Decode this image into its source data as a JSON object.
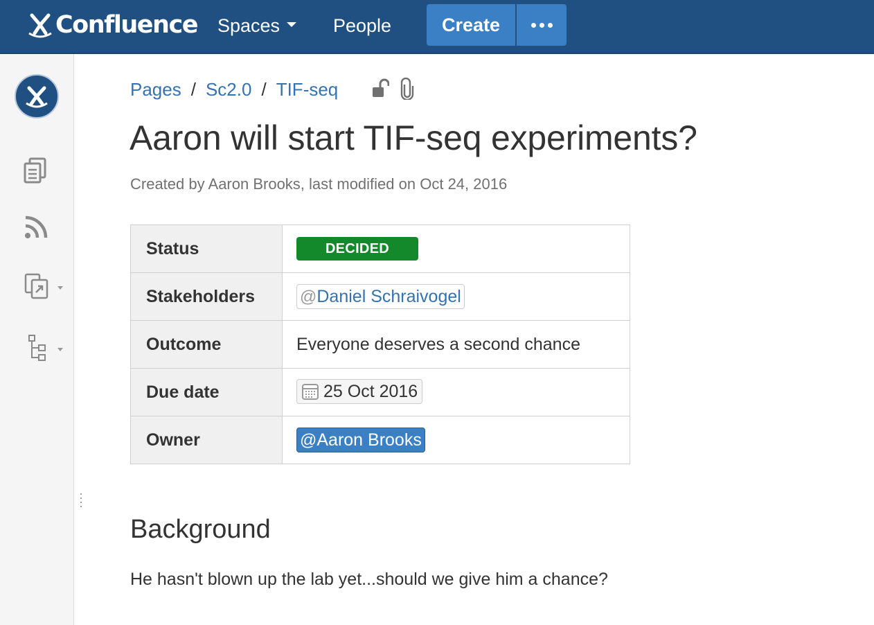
{
  "nav": {
    "logo_text": "Confluence",
    "spaces_label": "Spaces",
    "people_label": "People",
    "create_label": "Create"
  },
  "breadcrumb": {
    "items": [
      "Pages",
      "Sc2.0",
      "TIF-seq"
    ],
    "separator": "/"
  },
  "page": {
    "title": "Aaron will start TIF-seq experiments?",
    "byline": "Created by Aaron Brooks, last modified on Oct 24, 2016"
  },
  "decision_table": {
    "status": {
      "label": "Status",
      "value": "DECIDED",
      "color": "#14892c"
    },
    "stakeholders": {
      "label": "Stakeholders",
      "at": "@",
      "value": "Daniel Schraivogel"
    },
    "outcome": {
      "label": "Outcome",
      "value": "Everyone deserves a second chance"
    },
    "due_date": {
      "label": "Due date",
      "value": "25 Oct 2016"
    },
    "owner": {
      "label": "Owner",
      "at": "@",
      "value": "Aaron Brooks"
    }
  },
  "background": {
    "heading": "Background",
    "text": "He hasn't blown up the lab yet...should we give him a chance?"
  },
  "icons": {
    "logo": "confluence-logo-icon",
    "space_avatar": "space-avatar-icon",
    "pages": "pages-icon",
    "feed": "rss-feed-icon",
    "shortcuts": "space-shortcuts-icon",
    "tree": "page-tree-icon",
    "restrictions": "unlock-icon",
    "attachments": "paperclip-icon",
    "calendar": "calendar-icon"
  },
  "colors": {
    "header_bg": "#205081",
    "button_bg": "#3b7fc4",
    "link": "#3572b0",
    "status_green": "#14892c"
  }
}
